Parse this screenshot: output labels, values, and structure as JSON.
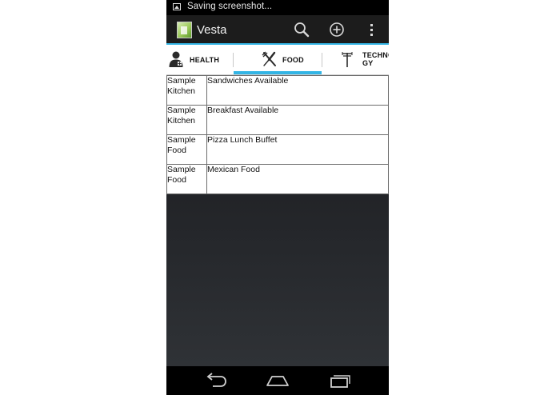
{
  "status_bar": {
    "notification_text": "Saving screenshot..."
  },
  "action_bar": {
    "title": "Vesta"
  },
  "tabs": [
    {
      "label": "HEALTH",
      "icon": "person-icon",
      "selected": false
    },
    {
      "label": "FOOD",
      "icon": "utensils-icon",
      "selected": true
    },
    {
      "label_lines": [
        "TECHNO",
        "GY"
      ],
      "icon": "antenna-icon",
      "selected": false
    }
  ],
  "listing": [
    {
      "name": [
        "Sample",
        "Kitchen"
      ],
      "description": "Sandwiches Available"
    },
    {
      "name": [
        "Sample",
        "Kitchen"
      ],
      "description": "Breakfast Available"
    },
    {
      "name": [
        "Sample",
        "Food"
      ],
      "description": "Pizza Lunch Buffet"
    },
    {
      "name": [
        "Sample",
        "Food"
      ],
      "description": "Mexican Food"
    }
  ],
  "colors": {
    "accent": "#33b5e5",
    "action_bar": "#1c1c1c",
    "status_bar": "#000000"
  }
}
